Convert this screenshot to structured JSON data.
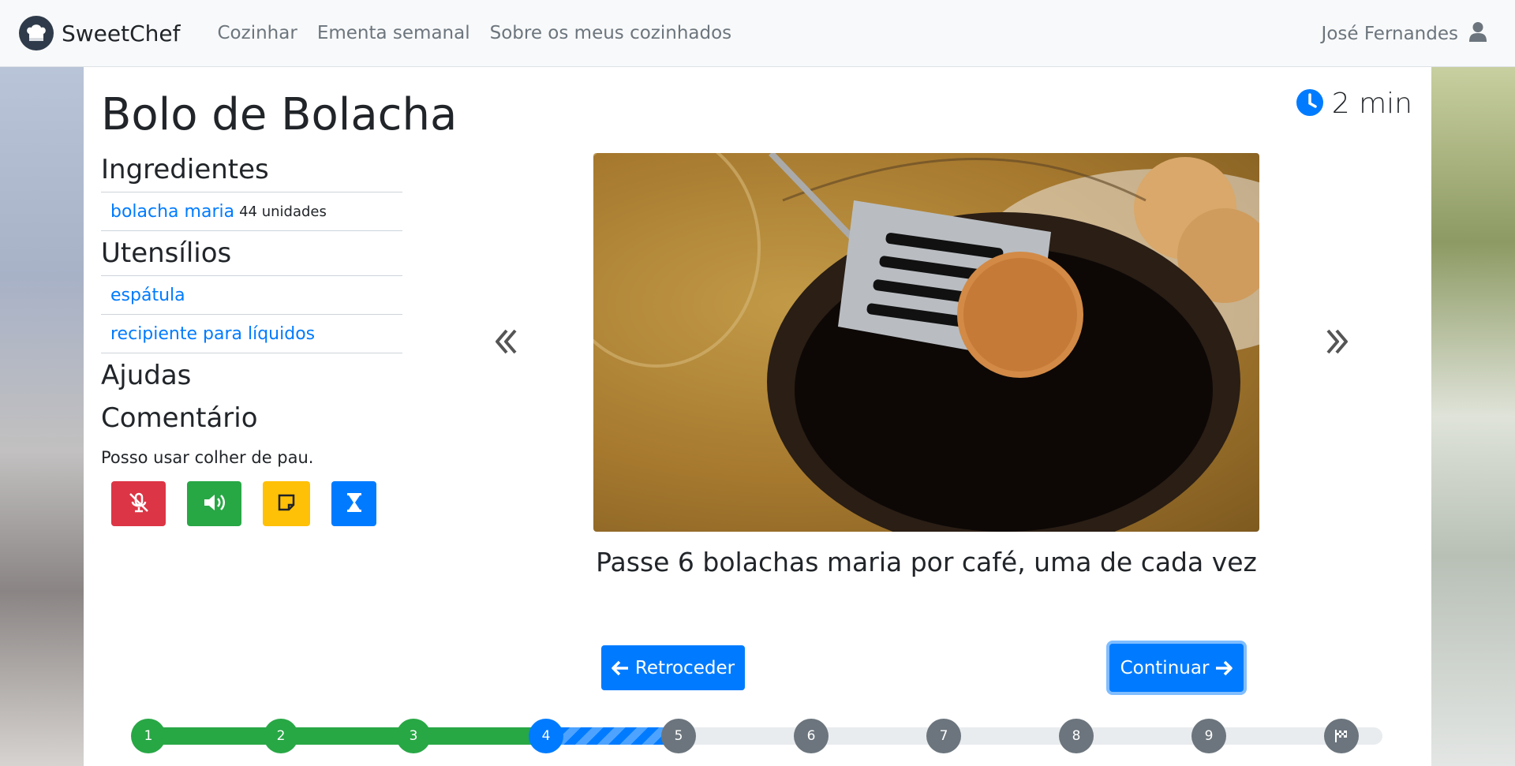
{
  "nav": {
    "brand": "SweetChef",
    "links": [
      "Cozinhar",
      "Ementa semanal",
      "Sobre os meus cozinhados"
    ],
    "user": "José Fernandes"
  },
  "recipe": {
    "title": "Bolo de Bolacha",
    "timer": "2 min",
    "ingredients_title": "Ingredientes",
    "ingredients": [
      {
        "name": "bolacha maria",
        "qty": "44 unidades"
      }
    ],
    "utensils_title": "Utensílios",
    "utensils": [
      "espátula",
      "recipiente para líquidos"
    ],
    "helps_title": "Ajudas",
    "comment_title": "Comentário",
    "comment": "Posso usar colher de pau.",
    "step_caption": "Passe 6 bolachas maria por café, uma de cada vez"
  },
  "controls": {
    "back_label": "Retroceder",
    "next_label": "Continuar"
  },
  "progress": {
    "steps": [
      "1",
      "2",
      "3",
      "4",
      "5",
      "6",
      "7",
      "8",
      "9"
    ],
    "current_step": 4,
    "total_steps": 10
  },
  "colors": {
    "primary": "#007bff",
    "success": "#28a745",
    "danger": "#dc3545",
    "warning": "#ffc107",
    "secondary": "#6c757d"
  },
  "icons": {
    "brand": "chef-hat-icon",
    "user": "user-icon",
    "timer": "clock-icon",
    "mute": "microphone-slash-icon",
    "volume": "volume-icon",
    "note": "sticky-note-icon",
    "hourglass": "hourglass-icon",
    "prev": "double-chevron-left-icon",
    "next": "double-chevron-right-icon",
    "finish": "checkered-flag-icon"
  }
}
